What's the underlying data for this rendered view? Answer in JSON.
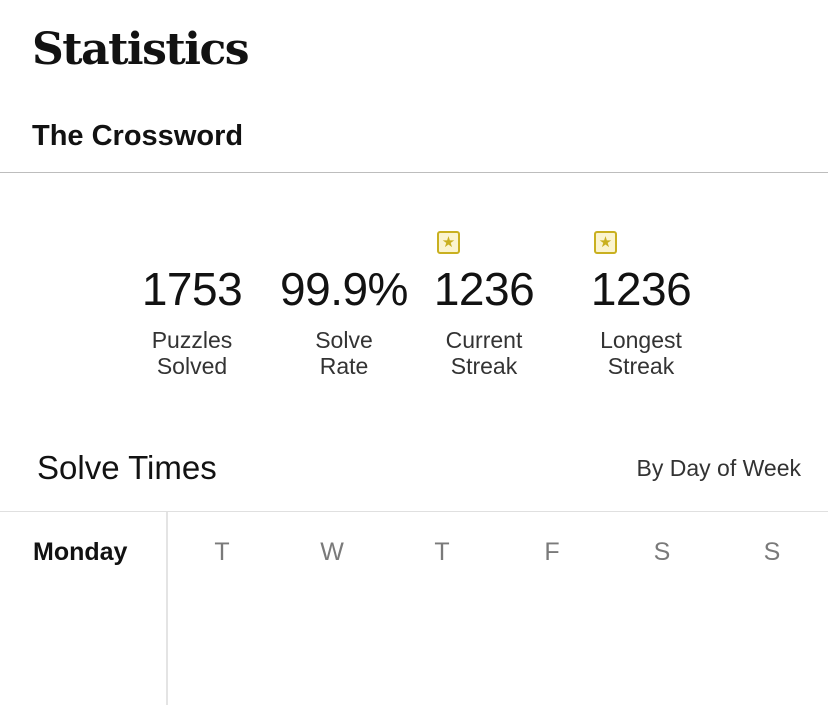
{
  "header": {
    "title": "Statistics",
    "game": "The Crossword"
  },
  "stats": [
    {
      "value": "1753",
      "label": "Puzzles\nSolved",
      "star": false
    },
    {
      "value": "99.9%",
      "label": "Solve\nRate",
      "star": false
    },
    {
      "value": "1236",
      "label": "Current\nStreak",
      "star": true,
      "icon": "star-icon"
    },
    {
      "value": "1236",
      "label": "Longest\nStreak",
      "star": true,
      "icon": "star-icon"
    }
  ],
  "solve_times": {
    "title": "Solve Times",
    "view_toggle": "By Day of Week",
    "selected_day": "Monday",
    "day_tabs": [
      "T",
      "W",
      "T",
      "F",
      "S",
      "S"
    ]
  },
  "colors": {
    "star_accent": "#c9b020",
    "text": "#121212",
    "muted": "#7a7a7a"
  }
}
